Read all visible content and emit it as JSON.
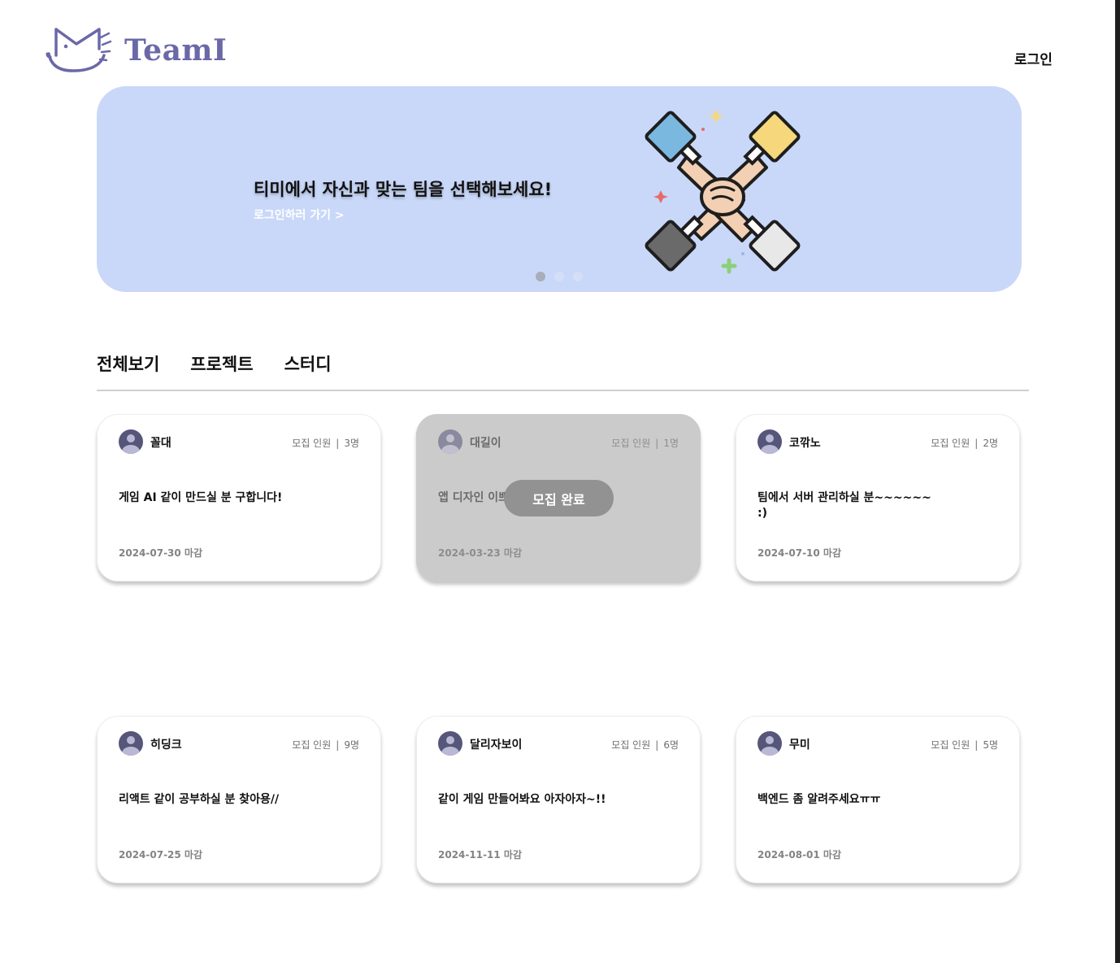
{
  "header": {
    "logo_text": "TeamI",
    "login_label": "로그인"
  },
  "banner": {
    "title": "티미에서 자신과 맞는 팀을 선택해보세요!",
    "link_label": "로그인하러 가기 >",
    "background_color": "#c9d8f9",
    "illustration": "stacked-hands-icon",
    "slide_count": 3,
    "active_slide": 1
  },
  "tabs": [
    {
      "label": "전체보기"
    },
    {
      "label": "프로젝트"
    },
    {
      "label": "스터디"
    }
  ],
  "posts": [
    {
      "author": "꼴대",
      "recruit_label": "모집 인원",
      "recruit_count": "3명",
      "title": "게임 AI 같이 만드실 분 구합니다!",
      "deadline": "2024-07-30 마감",
      "closed": false
    },
    {
      "author": "대길이",
      "recruit_label": "모집 인원",
      "recruit_count": "1명",
      "title": "앱 디자인 이쁘게 해주실 분!!",
      "deadline": "2024-03-23 마감",
      "closed": true,
      "closed_label": "모집 완료"
    },
    {
      "author": "코깎노",
      "recruit_label": "모집 인원",
      "recruit_count": "2명",
      "title": "팀에서 서버 관리하실 분~~~~~~ :)",
      "deadline": "2024-07-10 마감",
      "closed": false
    },
    {
      "author": "히딩크",
      "recruit_label": "모집 인원",
      "recruit_count": "9명",
      "title": "리액트 같이 공부하실 분 찾아용//",
      "deadline": "2024-07-25 마감",
      "closed": false
    },
    {
      "author": "달리자보이",
      "recruit_label": "모집 인원",
      "recruit_count": "6명",
      "title": "같이 게임 만들어봐요 아자아자~!!",
      "deadline": "2024-11-11 마감",
      "closed": false
    },
    {
      "author": "무미",
      "recruit_label": "모집 인원",
      "recruit_count": "5명",
      "title": "백엔드 좀 알려주세요ㅠㅠ",
      "deadline": "2024-08-01 마감",
      "closed": false
    }
  ],
  "colors": {
    "brand": "#6b68a8",
    "card_closed": "#cbcbcb",
    "badge_closed": "#929292"
  }
}
